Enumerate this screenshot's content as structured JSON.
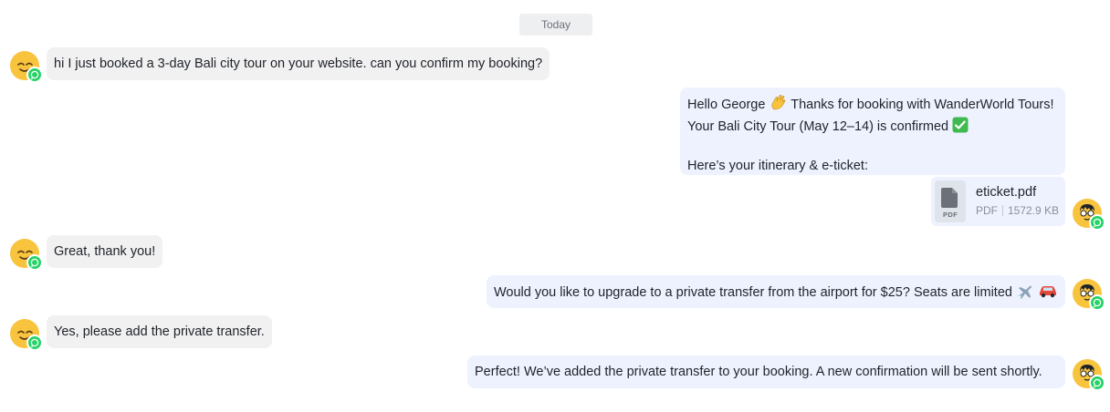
{
  "date_divider": "Today",
  "channel_badge_icon": "whatsapp-icon",
  "colors": {
    "incoming_bubble": "#f1f1f2",
    "outgoing_bubble": "#eef2ff",
    "avatar": "#f8c43e",
    "whatsapp": "#25d366"
  },
  "messages": [
    {
      "direction": "incoming",
      "text": "hi I just booked a 3-day Bali city tour on your website. can you confirm my booking?"
    },
    {
      "direction": "outgoing",
      "lines": [
        "Hello George",
        "Thanks for booking with WanderWorld Tours!",
        "Your Bali City Tour (May 12–14) is confirmed",
        "Here’s your itinerary & e-ticket:"
      ],
      "emojis": [
        "waving-hand",
        "check-mark"
      ]
    },
    {
      "direction": "outgoing",
      "attachment": {
        "type_label": "PDF",
        "name": "eticket.pdf",
        "kind": "PDF",
        "size": "1572.9 KB"
      }
    },
    {
      "direction": "incoming",
      "text": "Great, thank you!"
    },
    {
      "direction": "outgoing",
      "text": "Would you like to upgrade to a private transfer from the airport for $25? Seats are limited",
      "emojis": [
        "airplane",
        "car"
      ]
    },
    {
      "direction": "incoming",
      "text": "Yes, please add the private transfer."
    },
    {
      "direction": "outgoing",
      "text": "Perfect! We’ve added the private transfer to your booking. A new confirmation will be sent shortly."
    }
  ]
}
